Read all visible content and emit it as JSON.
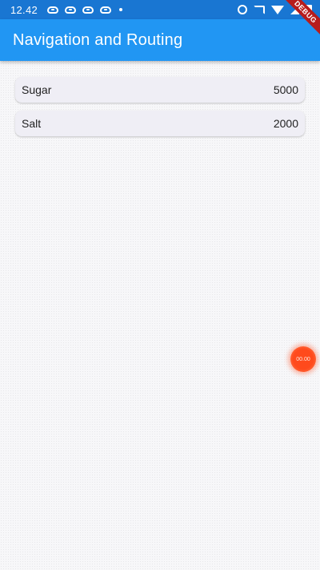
{
  "status_bar": {
    "time": "12.42",
    "notification_icons": [
      "game-controller-icon",
      "game-controller-icon",
      "game-controller-icon",
      "game-controller-icon"
    ],
    "right_icons": [
      "alarm-icon",
      "cast-icon",
      "wifi-icon",
      "signal-icon",
      "battery-icon"
    ]
  },
  "app_bar": {
    "title": "Navigation and Routing",
    "color": "#2196f3"
  },
  "debug_banner": {
    "label": "DEBUG",
    "color": "#b71c1c"
  },
  "items": [
    {
      "name": "Sugar",
      "value": "5000"
    },
    {
      "name": "Salt",
      "value": "2000"
    }
  ],
  "floating_timer": {
    "label": "00.00",
    "color": "#ff4a1c"
  }
}
